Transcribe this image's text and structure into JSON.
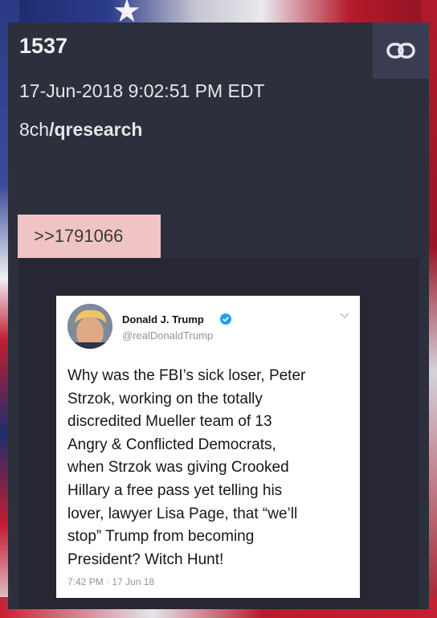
{
  "post": {
    "number": "1537",
    "timestamp": "17-Jun-2018 9:02:51 PM EDT",
    "board_site": "8ch",
    "board_slash": "/",
    "board_name": "qresearch",
    "reply_link": ">>1791066",
    "link_icon": "link-icon"
  },
  "tweet": {
    "author_name": "Donald J. Trump",
    "author_handle": "@realDonaldTrump",
    "verified_icon": "verified-badge-icon",
    "verified_color": "#1da1f2",
    "text_lines": [
      "Why was the FBI’s sick loser, Peter",
      "Strzok, working on the totally",
      "discredited Mueller team of 13",
      "Angry & Conflicted Democrats,",
      "when Strzok was giving Crooked",
      "Hillary a free pass yet telling his",
      "lover, lawyer Lisa Page, that “we’ll",
      "stop” Trump from becoming",
      "President? Witch Hunt!"
    ],
    "time": "7:42 PM · 17 Jun 18"
  },
  "colors": {
    "card_bg": "#2e2f3d",
    "reply_bg": "#f0c4c4",
    "link_button_bg": "#3b3d52"
  }
}
